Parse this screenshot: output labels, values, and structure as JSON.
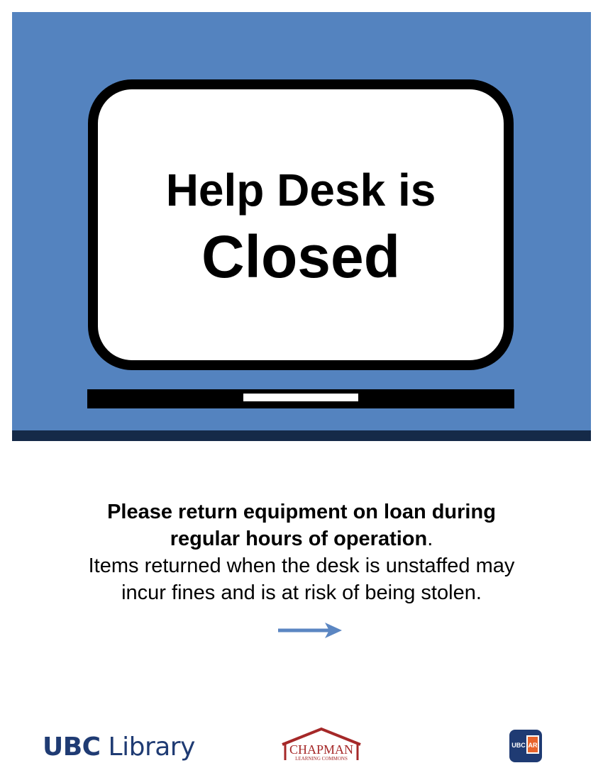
{
  "sign": {
    "headline_line1": "Help Desk is",
    "headline_line2": "Closed"
  },
  "message": {
    "bold_line1": "Please return equipment on loan during",
    "bold_line2": "regular hours of operation",
    "bold_line2_suffix": ".",
    "line3": "Items returned when the desk is unstaffed may",
    "line4": "incur fines and is at risk of being stolen."
  },
  "logos": {
    "ubc_library_bold": "UBC",
    "ubc_library_rest": " Library",
    "chapman_name": "CHAPMAN",
    "chapman_sub": "LEARNING COMMONS",
    "ubc_ar_left": "UBC",
    "ubc_ar_right": "AR"
  },
  "icons": {
    "monitor": "monitor-icon",
    "arrow": "arrow-right-icon"
  },
  "colors": {
    "banner": "#5483bf",
    "banner_base": "#152a48",
    "ubc_blue": "#1f3b73",
    "chapman_red": "#a52828",
    "ar_orange": "#e8642c",
    "arrow": "#5b86c2"
  }
}
